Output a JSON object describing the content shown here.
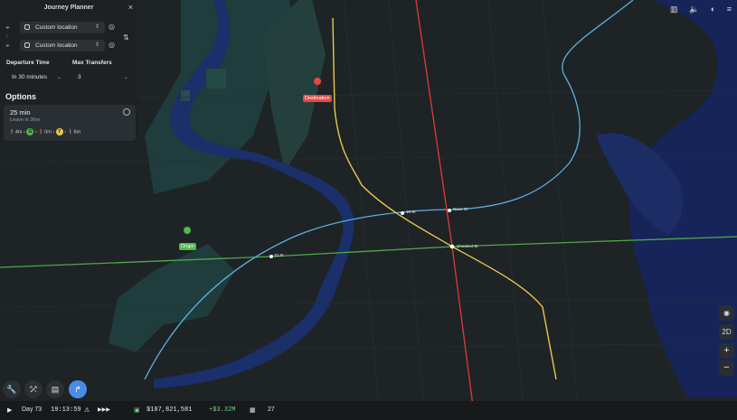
{
  "colors": {
    "accent": "#4a8de8",
    "origin": "#4fb84a",
    "destination": "#e54848",
    "line_yellow": "#e7c84a",
    "line_red": "#d23a36",
    "line_blue": "#5ab0e0",
    "line_green": "#4fa94a",
    "money_positive": "#6dd28a"
  },
  "planner": {
    "title": "Journey Planner",
    "close_icon": "×",
    "from_value": "Custom location",
    "to_value": "Custom location",
    "departure_label": "Departure Time",
    "departure_value": "In 30 minutes",
    "transfers_label": "Max Transfers",
    "transfers_value": "3",
    "options_heading": "Options",
    "option": {
      "duration": "25 min",
      "leave": "Leave in 36m",
      "walk1": "4m",
      "line1": "G",
      "walk2": "0m",
      "line2": "Y",
      "walk3": "6m"
    }
  },
  "map": {
    "origin_label": "Origin",
    "destination_label": "Destination",
    "stations": [
      "18 St",
      "Race St",
      "Chestnut St",
      "33 St"
    ]
  },
  "map_controls": {
    "view_mode": "2D",
    "zoom_in": "+",
    "zoom_out": "−"
  },
  "status": {
    "day": "Day 73",
    "time": "19:13:59",
    "money": "$187,821,581",
    "delta": "+$3.32M",
    "trains": "27"
  }
}
